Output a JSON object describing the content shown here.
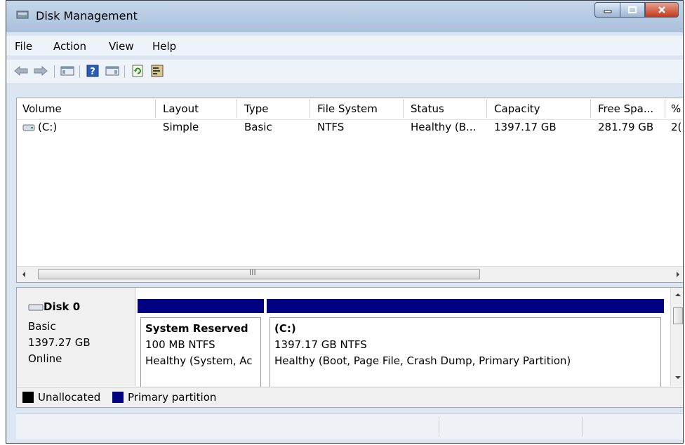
{
  "window": {
    "title": "Disk Management"
  },
  "menu": [
    "File",
    "Action",
    "View",
    "Help"
  ],
  "toolbar": {
    "icons": [
      "back-arrow-icon",
      "forward-arrow-icon",
      "console-tree-icon",
      "help-icon",
      "action-pane-icon",
      "refresh-icon",
      "properties-icon"
    ],
    "help_glyph": "?"
  },
  "volume_list": {
    "columns": [
      "Volume",
      "Layout",
      "Type",
      "File System",
      "Status",
      "Capacity",
      "Free Spa...",
      "%"
    ],
    "rows": [
      {
        "volume": "(C:)",
        "layout": "Simple",
        "type": "Basic",
        "fs": "NTFS",
        "status": "Healthy (B...",
        "capacity": "1397.17 GB",
        "free": "281.79 GB",
        "pct": "2("
      }
    ],
    "scroll_grip": "III"
  },
  "disk": {
    "name": "Disk 0",
    "type": "Basic",
    "size": "1397.27 GB",
    "state": "Online",
    "partitions": [
      {
        "name": "System Reserved",
        "size": "100 MB NTFS",
        "status": "Healthy (System, Ac"
      },
      {
        "name": "(C:)",
        "size": "1397.17 GB NTFS",
        "status": "Healthy (Boot, Page File, Crash Dump, Primary Partition)"
      }
    ]
  },
  "legend": [
    {
      "label": "Unallocated",
      "color": "#000000"
    },
    {
      "label": "Primary partition",
      "color": "#000080"
    }
  ]
}
